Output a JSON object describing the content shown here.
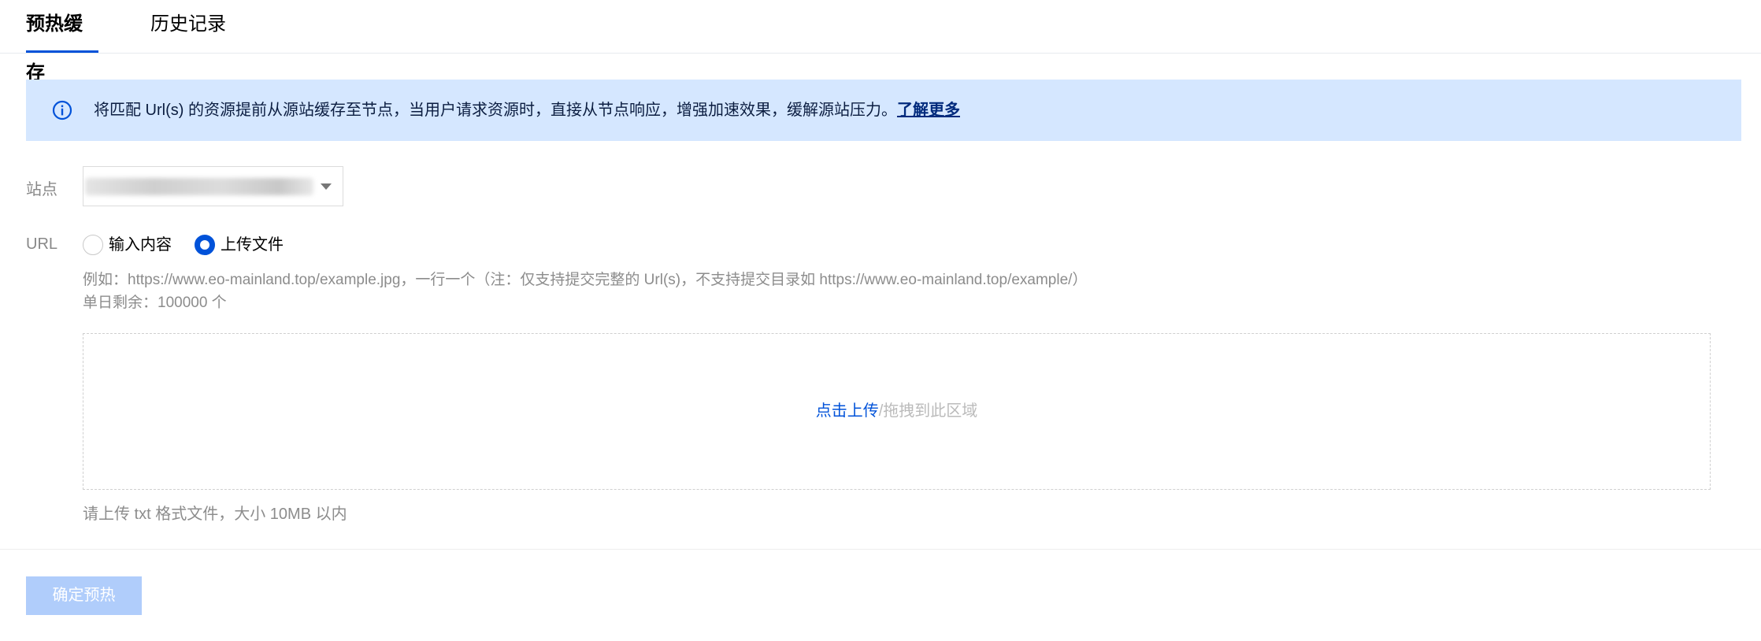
{
  "tabs": [
    {
      "label": "预热缓存",
      "active": true
    },
    {
      "label": "历史记录",
      "active": false
    }
  ],
  "banner": {
    "icon": "info-icon",
    "message": "将匹配 Url(s) 的资源提前从源站缓存至节点，当用户请求资源时，直接从节点响应，增强加速效果，缓解源站压力。",
    "link_label": "了解更多",
    "background": "#d5e7ff"
  },
  "form": {
    "site_label": "站点",
    "url_label": "URL",
    "radios": [
      {
        "label": "输入内容",
        "checked": false
      },
      {
        "label": "上传文件",
        "checked": true
      }
    ],
    "example_hint": "例如：https://www.eo-mainland.top/example.jpg，一行一个（注：仅支持提交完整的 Url(s)，不支持提交目录如 https://www.eo-mainland.top/example/）",
    "daily_remaining": "单日剩余：100000 个"
  },
  "upload": {
    "link_text": "点击上传",
    "rest_text": "/拖拽到此区域",
    "note": "请上传 txt 格式文件，大小 10MB 以内"
  },
  "footer": {
    "confirm_label": "确定预热"
  },
  "colors": {
    "accent": "#0052d9",
    "disabled_button": "#b0cdfb"
  }
}
